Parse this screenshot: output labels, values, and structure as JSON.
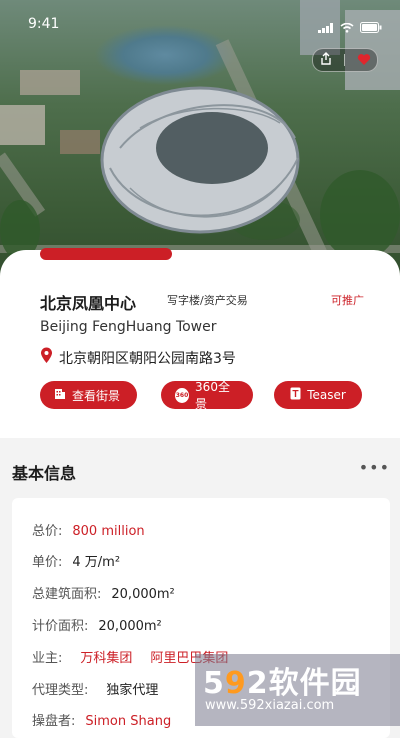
{
  "status_bar": {
    "time": "9:41"
  },
  "property": {
    "name_cn": "北京凤凰中心",
    "category": "写字楼/资产交易",
    "badge": "可推广",
    "name_en": "Beijing FengHuang Tower",
    "address": "北京朝阳区朝阳公园南路3号"
  },
  "actions": [
    {
      "label": "查看街景",
      "icon": "building-icon"
    },
    {
      "label": "360全景",
      "icon": "panorama-360-icon",
      "icon_text": "360"
    },
    {
      "label": "Teaser",
      "icon": "document-icon"
    }
  ],
  "basic_info": {
    "title": "基本信息",
    "more": "•••",
    "total_price_label": "总价:",
    "total_price": "800 million",
    "unit_price_label": "单价:",
    "unit_price": "4 万/m²",
    "gross_area_label": "总建筑面积:",
    "gross_area": "20,000m²",
    "billing_area_label": "计价面积:",
    "billing_area": "20,000m²",
    "owner_label": "业主:",
    "owner_1": "万科集团",
    "owner_2": "阿里巴巴集团",
    "agency_type_label": "代理类型:",
    "agency_type": "独家代理",
    "trader_label": "操盘者:",
    "trader": "Simon Shang"
  },
  "watermark": {
    "brand_prefix": "5",
    "brand_o": "9",
    "brand_rest": "2软件园",
    "url": "www.592xiazai.com"
  },
  "colors": {
    "accent": "#cc1f26",
    "card_bg": "#ffffff",
    "page_bg": "#f3f3f3"
  }
}
